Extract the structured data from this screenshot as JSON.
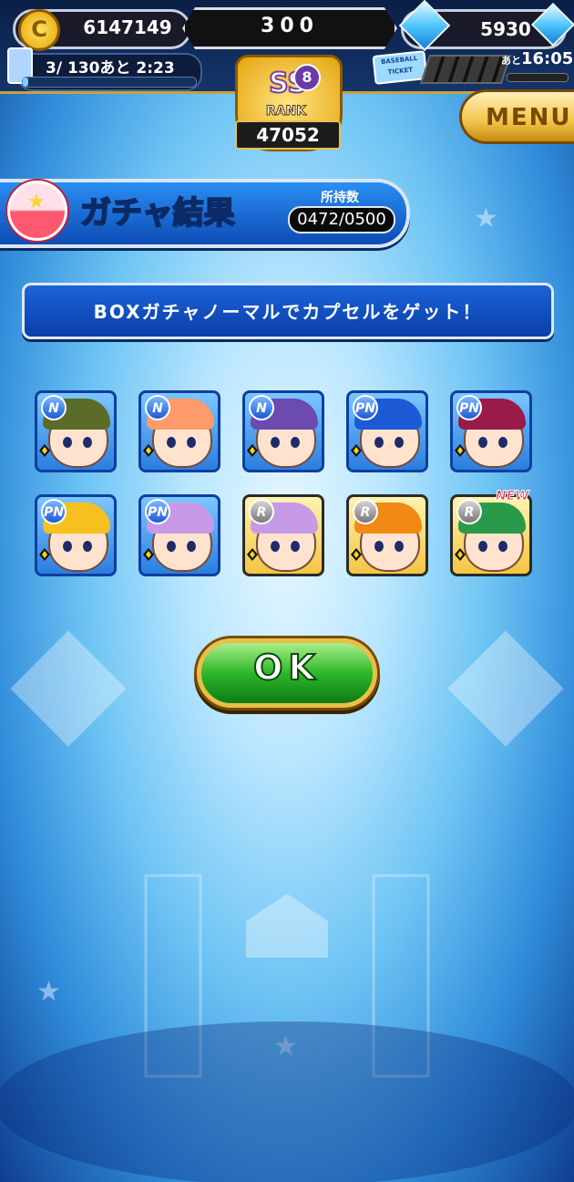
{
  "top_bar": {
    "coins": "6147149",
    "stamina": "300",
    "gems": "5930",
    "ticket_progress": "3/ 130あと 2:23",
    "ticket_fill": 0.03,
    "timer_label": "あと",
    "timer_value": "16:05",
    "baseball_ticket_label": "BASEBALL TICKET"
  },
  "rank": {
    "grade": "SS",
    "level": "8",
    "label": "RANK",
    "score": "47052"
  },
  "menu_label": "MENU",
  "header": {
    "title": "ガチャ結果",
    "stock_label": "所持数",
    "stock_value": "0472/0500"
  },
  "result_message": "BOXガチャノーマルでカプセルをゲット！",
  "cards": [
    {
      "rarity": "N",
      "hair": "#5a6b2a"
    },
    {
      "rarity": "N",
      "hair": "#ff9a6a"
    },
    {
      "rarity": "N",
      "hair": "#6b4bb0"
    },
    {
      "rarity": "PN",
      "hair": "#1d5ad6"
    },
    {
      "rarity": "PN",
      "hair": "#9a1a4a"
    },
    {
      "rarity": "PN",
      "hair": "#f5c020"
    },
    {
      "rarity": "PN",
      "hair": "#c79ae8"
    },
    {
      "rarity": "R",
      "hair": "#c79ae8"
    },
    {
      "rarity": "R",
      "hair": "#f08a14"
    },
    {
      "rarity": "R",
      "hair": "#2a9a4a"
    }
  ],
  "new_badge": "NEW",
  "ok_label": "OK",
  "colors": {
    "accent_gold": "#e7c04a",
    "panel_blue": "#0d4cb5",
    "ok_green": "#2fb72a"
  }
}
